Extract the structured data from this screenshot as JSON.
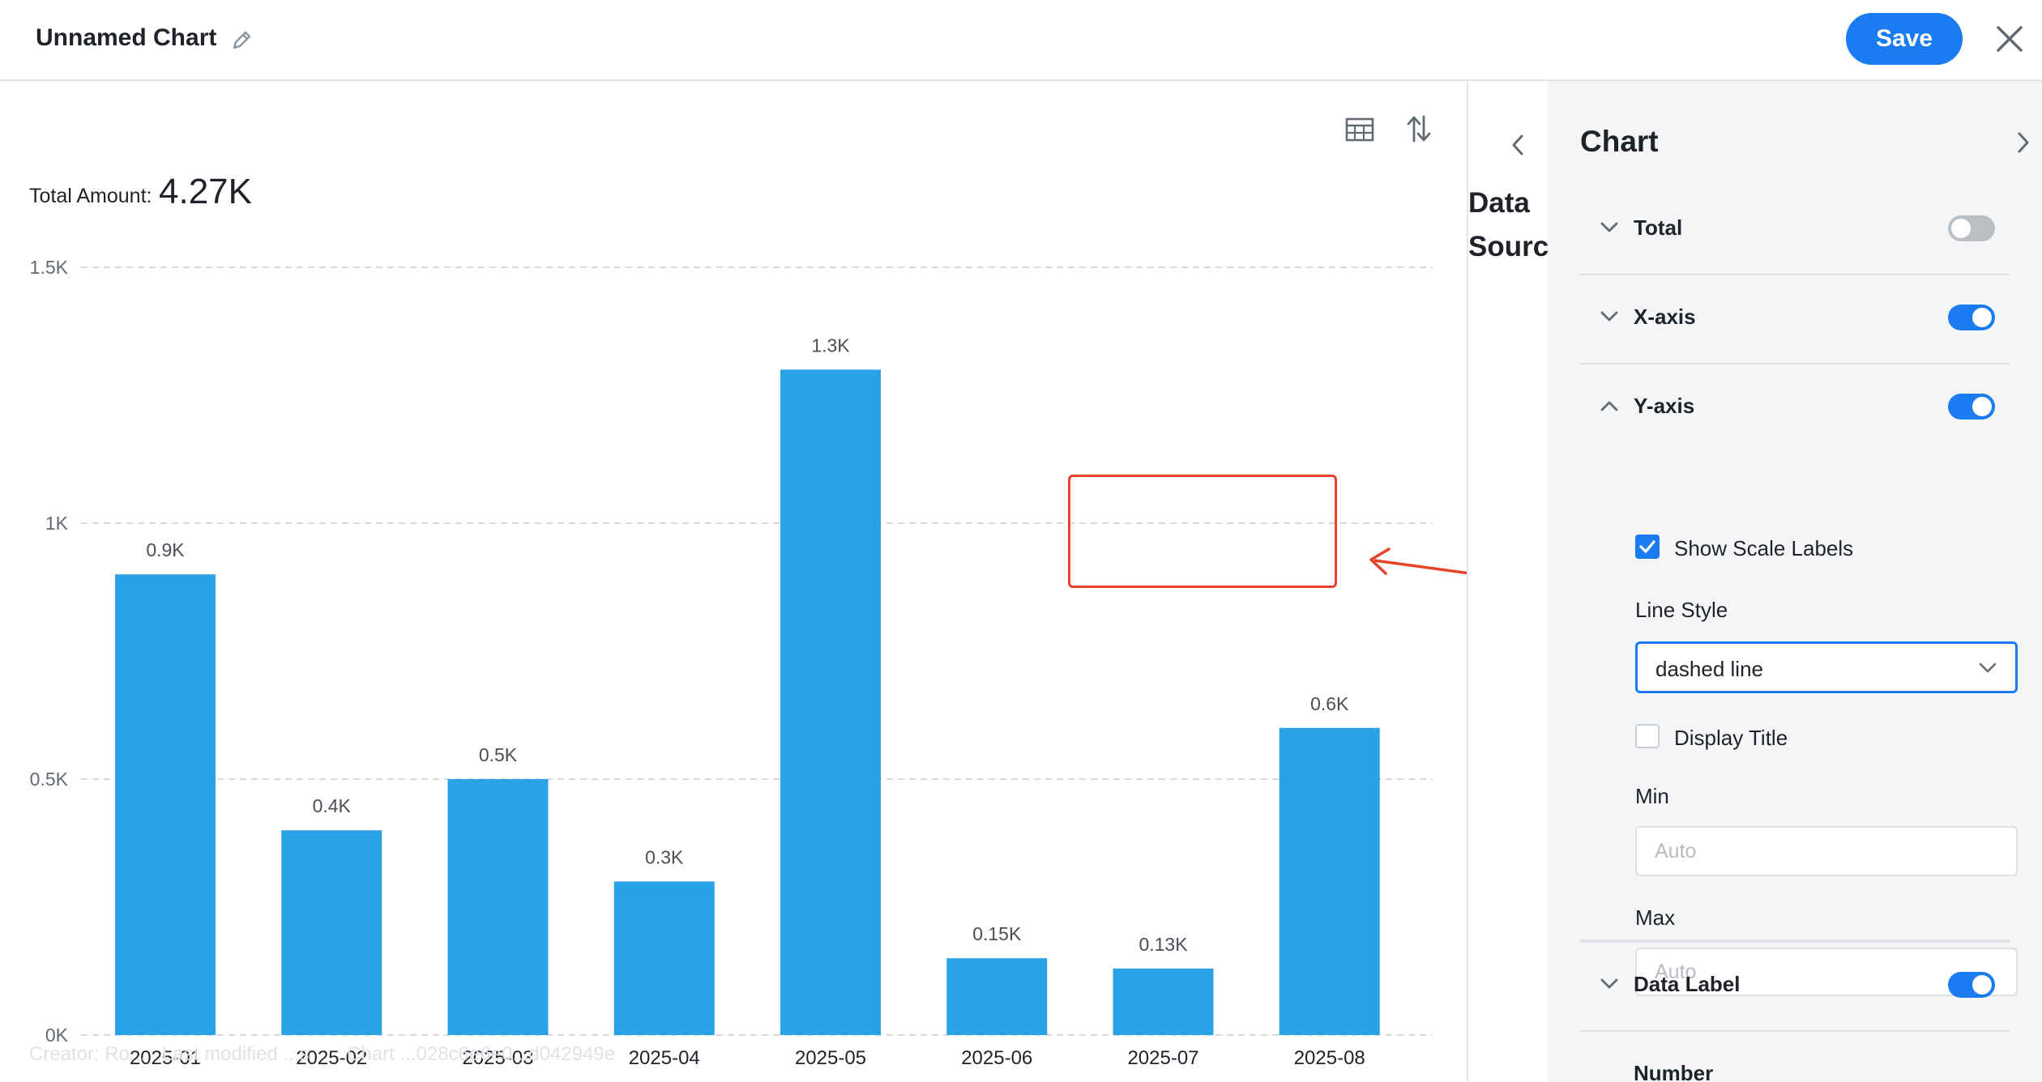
{
  "header": {
    "title": "Unnamed Chart",
    "save_label": "Save"
  },
  "summary": {
    "label": "Total Amount:",
    "value": "4.27K"
  },
  "watermark": "Creator: Ro...   Last modified ...s       Chart ...028c6e6e0...d042949e",
  "datasource_panel": {
    "title": "Data Source"
  },
  "config_panel": {
    "title": "Chart",
    "sections": {
      "total": {
        "label": "Total",
        "enabled": false
      },
      "x_axis": {
        "label": "X-axis",
        "enabled": true
      },
      "y_axis": {
        "label": "Y-axis",
        "enabled": true,
        "show_scale_labels": {
          "label": "Show Scale Labels",
          "checked": true
        },
        "line_style": {
          "label": "Line Style",
          "value": "dashed line"
        },
        "display_title": {
          "label": "Display Title",
          "checked": false
        },
        "min": {
          "label": "Min",
          "placeholder": "Auto",
          "value": ""
        },
        "max": {
          "label": "Max",
          "placeholder": "Auto",
          "value": ""
        }
      },
      "data_label": {
        "label": "Data Label",
        "enabled": true
      },
      "number": {
        "label": "Number"
      }
    }
  },
  "colors": {
    "accent": "#1a7cf0",
    "bar": "#29a3e6",
    "annotation": "#e8432a"
  },
  "chart_data": {
    "type": "bar",
    "categories": [
      "2025-01",
      "2025-02",
      "2025-03",
      "2025-04",
      "2025-05",
      "2025-06",
      "2025-07",
      "2025-08"
    ],
    "values": [
      900,
      400,
      500,
      300,
      1300,
      150,
      130,
      600
    ],
    "data_labels": [
      "0.9K",
      "0.4K",
      "0.5K",
      "0.3K",
      "1.3K",
      "0.15K",
      "0.13K",
      "0.6K"
    ],
    "ylim": [
      0,
      1500
    ],
    "yticks": [
      0,
      500,
      1000,
      1500
    ],
    "ytick_labels": [
      "0K",
      "0.5K",
      "1K",
      "1.5K"
    ],
    "grid": true,
    "grid_style": "dashed"
  }
}
